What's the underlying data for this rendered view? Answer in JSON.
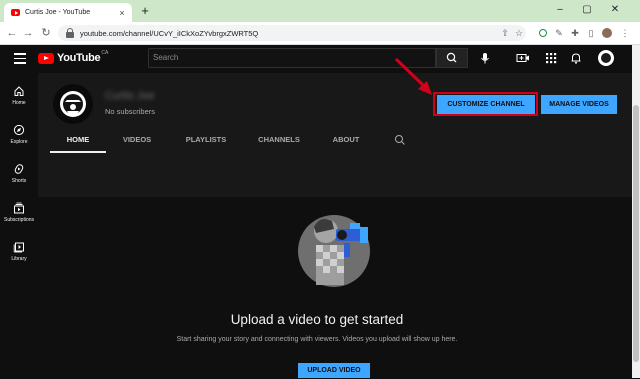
{
  "browser": {
    "tab_title": "Curtis Joe - YouTube",
    "tab_close": "×",
    "new_tab": "+",
    "url": "youtube.com/channel/UCvY_iICkXoZYvbrgxZWRT5Q",
    "window_controls": [
      "–",
      "▢",
      "✕"
    ]
  },
  "masthead": {
    "logo_text": "YouTube",
    "country_code": "CA",
    "search_placeholder": "Search"
  },
  "sidebar": {
    "items": [
      {
        "label": "Home",
        "icon": "home-icon"
      },
      {
        "label": "Explore",
        "icon": "compass-icon"
      },
      {
        "label": "Shorts",
        "icon": "shorts-icon"
      },
      {
        "label": "Subscriptions",
        "icon": "subscriptions-icon"
      },
      {
        "label": "Library",
        "icon": "library-icon"
      }
    ]
  },
  "channel": {
    "name": "Curtis Joe",
    "subscribers": "No subscribers",
    "customize_label": "CUSTOMIZE CHANNEL",
    "manage_label": "MANAGE VIDEOS"
  },
  "tabs": [
    "HOME",
    "VIDEOS",
    "PLAYLISTS",
    "CHANNELS",
    "ABOUT"
  ],
  "empty_state": {
    "title": "Upload a video to get started",
    "subtitle": "Start sharing your story and connecting with viewers. Videos you upload will show up here.",
    "button_label": "UPLOAD VIDEO"
  },
  "colors": {
    "accent_blue": "#3ea6ff",
    "highlight_red": "#d4001a",
    "chrome_green": "#cfe7c9"
  }
}
